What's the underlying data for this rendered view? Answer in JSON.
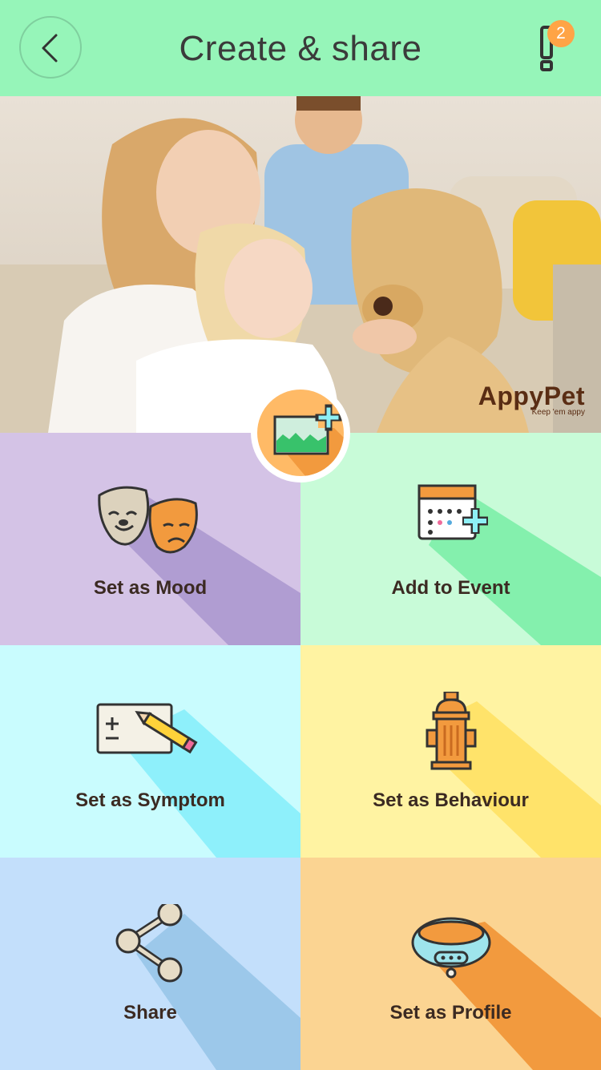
{
  "header": {
    "title": "Create & share",
    "back_icon": "chevron-left-icon",
    "notification_icon": "exclamation-icon",
    "notification_count": "2"
  },
  "hero": {
    "brand_name": "AppyPet",
    "brand_tagline": "Keep 'em appy",
    "add_photo_icon": "add-image-icon"
  },
  "colors": {
    "header_bg": "#96f5b9",
    "badge": "#ffa446",
    "mood": "#d4c3e6",
    "event": "#c8fbd8",
    "symptom": "#c9fcfe",
    "behaviour": "#fff3a2",
    "share": "#c3dffb",
    "profile": "#fbd492"
  },
  "actions": [
    {
      "label": "Set as Mood",
      "icon": "mood-masks-icon"
    },
    {
      "label": "Add to Event",
      "icon": "calendar-add-icon"
    },
    {
      "label": "Set as Symptom",
      "icon": "notepad-pencil-icon"
    },
    {
      "label": "Set as Behaviour",
      "icon": "fire-hydrant-icon"
    },
    {
      "label": "Share",
      "icon": "share-icon"
    },
    {
      "label": "Set as Profile",
      "icon": "collar-icon"
    }
  ]
}
